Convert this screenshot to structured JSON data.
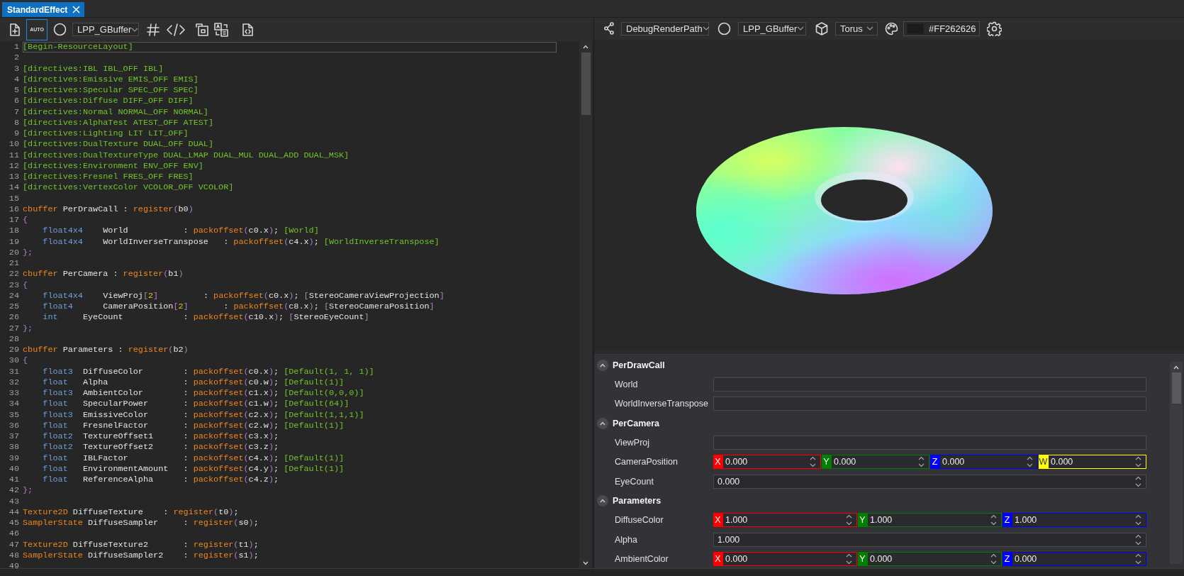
{
  "tab": {
    "label": "StandardEffect",
    "selected": true
  },
  "code_toolbar": {
    "auto": {
      "label": "AUTO",
      "on": true
    },
    "render_path": "LPP_GBuffer"
  },
  "editor": {
    "lines": [
      {
        "n": "1",
        "highlighted": true,
        "tokens": [
          {
            "kind": "attribute",
            "t": "[Begin-ResourceLayout]"
          }
        ]
      },
      {
        "n": "2",
        "highlighted": false
      },
      {
        "n": "3",
        "highlighted": false,
        "tokens": [
          {
            "kind": "attribute",
            "t": "[directives:IBL IBL_OFF IBL]"
          }
        ]
      },
      {
        "n": "4",
        "highlighted": false,
        "tokens": [
          {
            "kind": "attribute",
            "t": "[directives:Emissive EMIS_OFF EMIS]"
          }
        ]
      },
      {
        "n": "5",
        "highlighted": false,
        "tokens": [
          {
            "kind": "attribute",
            "t": "[directives:Specular SPEC_OFF SPEC]"
          }
        ]
      },
      {
        "n": "6",
        "highlighted": false,
        "tokens": [
          {
            "kind": "attribute",
            "t": "[directives:Diffuse DIFF_OFF DIFF]"
          }
        ]
      },
      {
        "n": "7",
        "highlighted": false,
        "tokens": [
          {
            "kind": "attribute",
            "t": "[directives:Normal NORMAL_OFF NORMAL]"
          }
        ]
      },
      {
        "n": "8",
        "highlighted": false,
        "tokens": [
          {
            "kind": "attribute",
            "t": "[directives:AlphaTest ATEST_OFF ATEST]"
          }
        ]
      },
      {
        "n": "9",
        "highlighted": false,
        "tokens": [
          {
            "kind": "attribute",
            "t": "[directives:Lighting LIT LIT_OFF]"
          }
        ]
      },
      {
        "n": "10",
        "highlighted": false,
        "tokens": [
          {
            "kind": "attribute",
            "t": "[directives:DualTexture DUAL_OFF DUAL]"
          }
        ]
      },
      {
        "n": "11",
        "highlighted": false,
        "tokens": [
          {
            "kind": "attribute",
            "t": "[directives:DualTextureType DUAL_LMAP DUAL_MUL DUAL_ADD DUAL_MSK]"
          }
        ]
      },
      {
        "n": "12",
        "highlighted": false,
        "tokens": [
          {
            "kind": "attribute",
            "t": "[directives:Environment ENV_OFF ENV]"
          }
        ]
      },
      {
        "n": "13",
        "highlighted": false,
        "tokens": [
          {
            "kind": "attribute",
            "t": "[directives:Fresnel FRES_OFF FRES]"
          }
        ]
      },
      {
        "n": "14",
        "highlighted": false,
        "tokens": [
          {
            "kind": "attribute",
            "t": "[directives:VertexColor VCOLOR_OFF VCOLOR]"
          }
        ]
      },
      {
        "n": "15",
        "highlighted": false
      },
      {
        "n": "16",
        "highlighted": false,
        "tokens": [
          {
            "kind": "keyword",
            "t": "cbuffer"
          },
          {
            "kind": "text",
            "t": " PerDrawCall : "
          },
          {
            "kind": "keyword",
            "t": "register"
          },
          {
            "kind": "punct",
            "t": "("
          },
          {
            "kind": "text",
            "t": "b0"
          },
          {
            "kind": "punct",
            "t": ")"
          }
        ]
      },
      {
        "n": "17",
        "highlighted": false,
        "tokens": [
          {
            "kind": "punct",
            "t": "{"
          }
        ]
      },
      {
        "n": "18",
        "highlighted": false,
        "tokens": [
          {
            "kind": "type",
            "t": "    float4x4"
          },
          {
            "kind": "text",
            "t": "    World           : "
          },
          {
            "kind": "keyword",
            "t": "packoffset"
          },
          {
            "kind": "punct",
            "t": "("
          },
          {
            "kind": "text",
            "t": "c0.x"
          },
          {
            "kind": "punct",
            "t": ")"
          },
          {
            "kind": "text",
            "t": "; "
          },
          {
            "kind": "attribute",
            "t": "[World]"
          }
        ]
      },
      {
        "n": "19",
        "highlighted": false,
        "tokens": [
          {
            "kind": "type",
            "t": "    float4x4"
          },
          {
            "kind": "text",
            "t": "    WorldInverseTranspose   : "
          },
          {
            "kind": "keyword",
            "t": "packoffset"
          },
          {
            "kind": "punct",
            "t": "("
          },
          {
            "kind": "text",
            "t": "c4.x"
          },
          {
            "kind": "punct",
            "t": ")"
          },
          {
            "kind": "text",
            "t": "; "
          },
          {
            "kind": "attribute",
            "t": "[WorldInverseTranspose]"
          }
        ]
      },
      {
        "n": "20",
        "highlighted": false,
        "tokens": [
          {
            "kind": "punct",
            "t": "};"
          }
        ]
      },
      {
        "n": "21",
        "highlighted": false
      },
      {
        "n": "22",
        "highlighted": false,
        "tokens": [
          {
            "kind": "keyword",
            "t": "cbuffer"
          },
          {
            "kind": "text",
            "t": " PerCamera : "
          },
          {
            "kind": "keyword",
            "t": "register"
          },
          {
            "kind": "punct",
            "t": "("
          },
          {
            "kind": "text",
            "t": "b1"
          },
          {
            "kind": "punct",
            "t": ")"
          }
        ]
      },
      {
        "n": "23",
        "highlighted": false,
        "tokens": [
          {
            "kind": "punct",
            "t": "{"
          }
        ]
      },
      {
        "n": "24",
        "highlighted": false,
        "tokens": [
          {
            "kind": "type",
            "t": "    float4x4"
          },
          {
            "kind": "text",
            "t": "    ViewProj"
          },
          {
            "kind": "punct",
            "t": "["
          },
          {
            "kind": "number",
            "t": "2"
          },
          {
            "kind": "punct",
            "t": "]"
          },
          {
            "kind": "text",
            "t": "         : "
          },
          {
            "kind": "keyword",
            "t": "packoffset"
          },
          {
            "kind": "punct",
            "t": "("
          },
          {
            "kind": "text",
            "t": "c0.x"
          },
          {
            "kind": "punct",
            "t": ")"
          },
          {
            "kind": "text",
            "t": "; "
          },
          {
            "kind": "punct",
            "t": "["
          },
          {
            "kind": "text",
            "t": "StereoCameraViewProjection"
          },
          {
            "kind": "punct",
            "t": "]"
          }
        ]
      },
      {
        "n": "25",
        "highlighted": false,
        "tokens": [
          {
            "kind": "type",
            "t": "    float4"
          },
          {
            "kind": "text",
            "t": "      CameraPosition"
          },
          {
            "kind": "punct",
            "t": "["
          },
          {
            "kind": "number",
            "t": "2"
          },
          {
            "kind": "punct",
            "t": "]"
          },
          {
            "kind": "text",
            "t": "       : "
          },
          {
            "kind": "keyword",
            "t": "packoffset"
          },
          {
            "kind": "punct",
            "t": "("
          },
          {
            "kind": "text",
            "t": "c8.x"
          },
          {
            "kind": "punct",
            "t": ")"
          },
          {
            "kind": "text",
            "t": "; "
          },
          {
            "kind": "punct",
            "t": "["
          },
          {
            "kind": "text",
            "t": "StereoCameraPosition"
          },
          {
            "kind": "punct",
            "t": "]"
          }
        ]
      },
      {
        "n": "26",
        "highlighted": false,
        "tokens": [
          {
            "kind": "type",
            "t": "    int"
          },
          {
            "kind": "text",
            "t": "     EyeCount            : "
          },
          {
            "kind": "keyword",
            "t": "packoffset"
          },
          {
            "kind": "punct",
            "t": "("
          },
          {
            "kind": "text",
            "t": "c10.x"
          },
          {
            "kind": "punct",
            "t": ")"
          },
          {
            "kind": "text",
            "t": "; "
          },
          {
            "kind": "punct",
            "t": "["
          },
          {
            "kind": "text",
            "t": "StereoEyeCount"
          },
          {
            "kind": "punct",
            "t": "]"
          }
        ]
      },
      {
        "n": "27",
        "highlighted": false,
        "tokens": [
          {
            "kind": "punct",
            "t": "};"
          }
        ]
      },
      {
        "n": "28",
        "highlighted": false
      },
      {
        "n": "29",
        "highlighted": false,
        "tokens": [
          {
            "kind": "keyword",
            "t": "cbuffer"
          },
          {
            "kind": "text",
            "t": " Parameters : "
          },
          {
            "kind": "keyword",
            "t": "register"
          },
          {
            "kind": "punct",
            "t": "("
          },
          {
            "kind": "text",
            "t": "b2"
          },
          {
            "kind": "punct",
            "t": ")"
          }
        ]
      },
      {
        "n": "30",
        "highlighted": false,
        "tokens": [
          {
            "kind": "punct",
            "t": "{"
          }
        ]
      },
      {
        "n": "31",
        "highlighted": false,
        "tokens": [
          {
            "kind": "type",
            "t": "    float3"
          },
          {
            "kind": "text",
            "t": "  DiffuseColor        : "
          },
          {
            "kind": "keyword",
            "t": "packoffset"
          },
          {
            "kind": "punct",
            "t": "("
          },
          {
            "kind": "text",
            "t": "c0.x"
          },
          {
            "kind": "punct",
            "t": ")"
          },
          {
            "kind": "text",
            "t": "; "
          },
          {
            "kind": "attribute",
            "t": "[Default(1, 1, 1)]"
          }
        ]
      },
      {
        "n": "32",
        "highlighted": false,
        "tokens": [
          {
            "kind": "type",
            "t": "    float"
          },
          {
            "kind": "text",
            "t": "   Alpha               : "
          },
          {
            "kind": "keyword",
            "t": "packoffset"
          },
          {
            "kind": "punct",
            "t": "("
          },
          {
            "kind": "text",
            "t": "c0.w"
          },
          {
            "kind": "punct",
            "t": ")"
          },
          {
            "kind": "text",
            "t": "; "
          },
          {
            "kind": "attribute",
            "t": "[Default(1)]"
          }
        ]
      },
      {
        "n": "33",
        "highlighted": false,
        "tokens": [
          {
            "kind": "type",
            "t": "    float3"
          },
          {
            "kind": "text",
            "t": "  AmbientColor        : "
          },
          {
            "kind": "keyword",
            "t": "packoffset"
          },
          {
            "kind": "punct",
            "t": "("
          },
          {
            "kind": "text",
            "t": "c1.x"
          },
          {
            "kind": "punct",
            "t": ")"
          },
          {
            "kind": "text",
            "t": "; "
          },
          {
            "kind": "attribute",
            "t": "[Default(0,0,0)]"
          }
        ]
      },
      {
        "n": "34",
        "highlighted": false,
        "tokens": [
          {
            "kind": "type",
            "t": "    float"
          },
          {
            "kind": "text",
            "t": "   SpecularPower       : "
          },
          {
            "kind": "keyword",
            "t": "packoffset"
          },
          {
            "kind": "punct",
            "t": "("
          },
          {
            "kind": "text",
            "t": "c1.w"
          },
          {
            "kind": "punct",
            "t": ")"
          },
          {
            "kind": "text",
            "t": "; "
          },
          {
            "kind": "attribute",
            "t": "[Default(64)]"
          }
        ]
      },
      {
        "n": "35",
        "highlighted": false,
        "tokens": [
          {
            "kind": "type",
            "t": "    float3"
          },
          {
            "kind": "text",
            "t": "  EmissiveColor       : "
          },
          {
            "kind": "keyword",
            "t": "packoffset"
          },
          {
            "kind": "punct",
            "t": "("
          },
          {
            "kind": "text",
            "t": "c2.x"
          },
          {
            "kind": "punct",
            "t": ")"
          },
          {
            "kind": "text",
            "t": "; "
          },
          {
            "kind": "attribute",
            "t": "[Default(1,1,1)]"
          }
        ]
      },
      {
        "n": "36",
        "highlighted": false,
        "tokens": [
          {
            "kind": "type",
            "t": "    float"
          },
          {
            "kind": "text",
            "t": "   FresnelFactor       : "
          },
          {
            "kind": "keyword",
            "t": "packoffset"
          },
          {
            "kind": "punct",
            "t": "("
          },
          {
            "kind": "text",
            "t": "c2.w"
          },
          {
            "kind": "punct",
            "t": ")"
          },
          {
            "kind": "text",
            "t": "; "
          },
          {
            "kind": "attribute",
            "t": "[Default(1)]"
          }
        ]
      },
      {
        "n": "37",
        "highlighted": false,
        "tokens": [
          {
            "kind": "type",
            "t": "    float2"
          },
          {
            "kind": "text",
            "t": "  TextureOffset1      : "
          },
          {
            "kind": "keyword",
            "t": "packoffset"
          },
          {
            "kind": "punct",
            "t": "("
          },
          {
            "kind": "text",
            "t": "c3.x"
          },
          {
            "kind": "punct",
            "t": ")"
          },
          {
            "kind": "text",
            "t": ";"
          }
        ]
      },
      {
        "n": "38",
        "highlighted": false,
        "tokens": [
          {
            "kind": "type",
            "t": "    float2"
          },
          {
            "kind": "text",
            "t": "  TextureOffset2      : "
          },
          {
            "kind": "keyword",
            "t": "packoffset"
          },
          {
            "kind": "punct",
            "t": "("
          },
          {
            "kind": "text",
            "t": "c3.z"
          },
          {
            "kind": "punct",
            "t": ")"
          },
          {
            "kind": "text",
            "t": ";"
          }
        ]
      },
      {
        "n": "39",
        "highlighted": false,
        "tokens": [
          {
            "kind": "type",
            "t": "    float"
          },
          {
            "kind": "text",
            "t": "   IBLFactor           : "
          },
          {
            "kind": "keyword",
            "t": "packoffset"
          },
          {
            "kind": "punct",
            "t": "("
          },
          {
            "kind": "text",
            "t": "c4.x"
          },
          {
            "kind": "punct",
            "t": ")"
          },
          {
            "kind": "text",
            "t": "; "
          },
          {
            "kind": "attribute",
            "t": "[Default(1)]"
          }
        ]
      },
      {
        "n": "40",
        "highlighted": false,
        "tokens": [
          {
            "kind": "type",
            "t": "    float"
          },
          {
            "kind": "text",
            "t": "   EnvironmentAmount   : "
          },
          {
            "kind": "keyword",
            "t": "packoffset"
          },
          {
            "kind": "punct",
            "t": "("
          },
          {
            "kind": "text",
            "t": "c4.y"
          },
          {
            "kind": "punct",
            "t": ")"
          },
          {
            "kind": "text",
            "t": "; "
          },
          {
            "kind": "attribute",
            "t": "[Default(1)]"
          }
        ]
      },
      {
        "n": "41",
        "highlighted": false,
        "tokens": [
          {
            "kind": "type",
            "t": "    float"
          },
          {
            "kind": "text",
            "t": "   ReferenceAlpha      : "
          },
          {
            "kind": "keyword",
            "t": "packoffset"
          },
          {
            "kind": "punct",
            "t": "("
          },
          {
            "kind": "text",
            "t": "c4.z"
          },
          {
            "kind": "punct",
            "t": ")"
          },
          {
            "kind": "text",
            "t": ";"
          }
        ]
      },
      {
        "n": "42",
        "highlighted": false,
        "tokens": [
          {
            "kind": "punct",
            "t": "};"
          }
        ]
      },
      {
        "n": "43",
        "highlighted": false
      },
      {
        "n": "44",
        "highlighted": false,
        "tokens": [
          {
            "kind": "keyword",
            "t": "Texture2D"
          },
          {
            "kind": "text",
            "t": " DiffuseTexture    : "
          },
          {
            "kind": "keyword",
            "t": "register"
          },
          {
            "kind": "punct",
            "t": "("
          },
          {
            "kind": "text",
            "t": "t0"
          },
          {
            "kind": "punct",
            "t": ")"
          },
          {
            "kind": "text",
            "t": ";"
          }
        ]
      },
      {
        "n": "45",
        "highlighted": false,
        "tokens": [
          {
            "kind": "keyword",
            "t": "SamplerState"
          },
          {
            "kind": "text",
            "t": " DiffuseSampler     : "
          },
          {
            "kind": "keyword",
            "t": "register"
          },
          {
            "kind": "punct",
            "t": "("
          },
          {
            "kind": "text",
            "t": "s0"
          },
          {
            "kind": "punct",
            "t": ")"
          },
          {
            "kind": "text",
            "t": ";"
          }
        ]
      },
      {
        "n": "46",
        "highlighted": false
      },
      {
        "n": "47",
        "highlighted": false,
        "tokens": [
          {
            "kind": "keyword",
            "t": "Texture2D"
          },
          {
            "kind": "text",
            "t": " DiffuseTexture2       : "
          },
          {
            "kind": "keyword",
            "t": "register"
          },
          {
            "kind": "punct",
            "t": "("
          },
          {
            "kind": "text",
            "t": "t1"
          },
          {
            "kind": "punct",
            "t": ")"
          },
          {
            "kind": "text",
            "t": ";"
          }
        ]
      },
      {
        "n": "48",
        "highlighted": false,
        "tokens": [
          {
            "kind": "keyword",
            "t": "SamplerState"
          },
          {
            "kind": "text",
            "t": " DiffuseSampler2    : "
          },
          {
            "kind": "keyword",
            "t": "register"
          },
          {
            "kind": "punct",
            "t": "("
          },
          {
            "kind": "text",
            "t": "s1"
          },
          {
            "kind": "punct",
            "t": ")"
          },
          {
            "kind": "text",
            "t": ";"
          }
        ]
      },
      {
        "n": "49",
        "highlighted": false
      }
    ]
  },
  "viewer_toolbar": {
    "render_mode": "DebugRenderPath",
    "render_path": "LPP_GBuffer",
    "mesh": "Torus",
    "background_color": "#FF262626"
  },
  "properties": {
    "groups": [
      {
        "title": "PerDrawCall",
        "expanded": true,
        "rows": [
          {
            "label": "World",
            "kind": "empty"
          },
          {
            "label": "WorldInverseTranspose",
            "kind": "empty"
          }
        ]
      },
      {
        "title": "PerCamera",
        "expanded": true,
        "rows": [
          {
            "label": "ViewProj",
            "kind": "empty"
          },
          {
            "label": "CameraPosition",
            "kind": "vector",
            "components": [
              {
                "axis": "X",
                "color": "#ff0000",
                "value": "0.000"
              },
              {
                "axis": "Y",
                "color": "#008000",
                "value": "0.000"
              },
              {
                "axis": "Z",
                "color": "#0000ff",
                "value": "0.000"
              },
              {
                "axis": "W",
                "color": "#ffff00",
                "value": "0.000"
              }
            ]
          },
          {
            "label": "EyeCount",
            "kind": "number",
            "value": "0.000"
          }
        ]
      },
      {
        "title": "Parameters",
        "expanded": true,
        "rows": [
          {
            "label": "DiffuseColor",
            "kind": "vector",
            "components": [
              {
                "axis": "X",
                "color": "#ff0000",
                "value": "1.000"
              },
              {
                "axis": "Y",
                "color": "#008000",
                "value": "1.000"
              },
              {
                "axis": "Z",
                "color": "#0000ff",
                "value": "1.000"
              }
            ]
          },
          {
            "label": "Alpha",
            "kind": "number",
            "value": "1.000"
          },
          {
            "label": "AmbientColor",
            "kind": "vector",
            "components": [
              {
                "axis": "X",
                "color": "#ff0000",
                "value": "0.000"
              },
              {
                "axis": "Y",
                "color": "#008000",
                "value": "0.000"
              },
              {
                "axis": "Z",
                "color": "#0000ff",
                "value": "0.000"
              }
            ]
          }
        ]
      }
    ]
  }
}
